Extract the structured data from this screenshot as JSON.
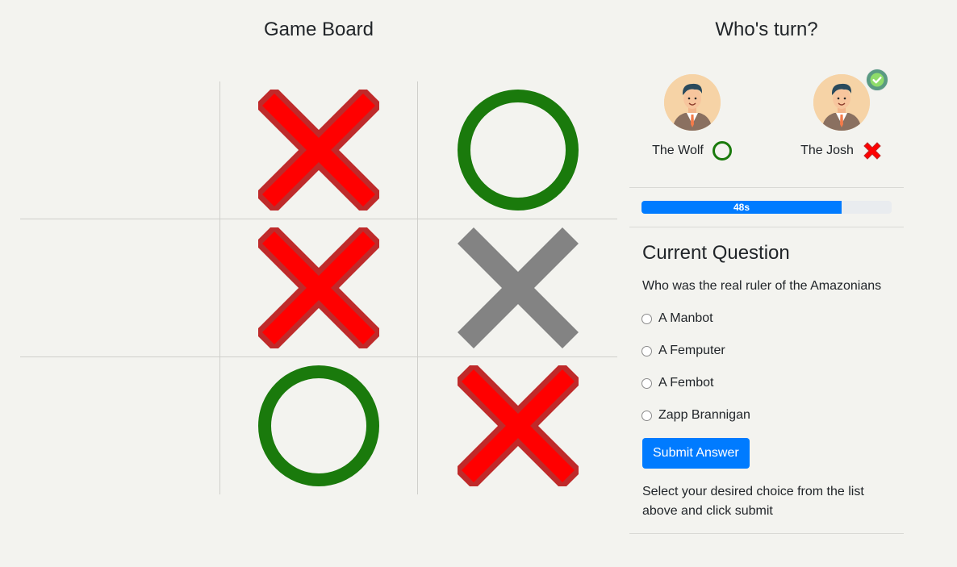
{
  "board": {
    "title": "Game Board",
    "cells": [
      "",
      "X",
      "O",
      "",
      "X",
      "X-gray",
      "",
      "O",
      "X"
    ]
  },
  "sidebar": {
    "title": "Who's turn?",
    "players": [
      {
        "name": "The Wolf",
        "mark": "O",
        "current_turn": false
      },
      {
        "name": "The Josh",
        "mark": "X",
        "current_turn": true
      }
    ],
    "timer": {
      "label": "48s",
      "fraction": 0.8
    }
  },
  "question": {
    "title": "Current Question",
    "text": "Who was the real ruler of the Amazonians",
    "options": [
      "A Manbot",
      "A Femputer",
      "A Fembot",
      "Zapp Brannigan"
    ],
    "submit_label": "Submit Answer",
    "hint": "Select your desired choice from the list above and click submit"
  },
  "colors": {
    "x_fill": "#ff0000",
    "x_stroke": "#bf2a2a",
    "o_stroke": "#1a7a0c",
    "x_disabled": "#838383",
    "accent": "#007bff"
  },
  "icons": {
    "turn_indicator": "check-circle-icon",
    "avatar": "user-avatar-icon"
  }
}
